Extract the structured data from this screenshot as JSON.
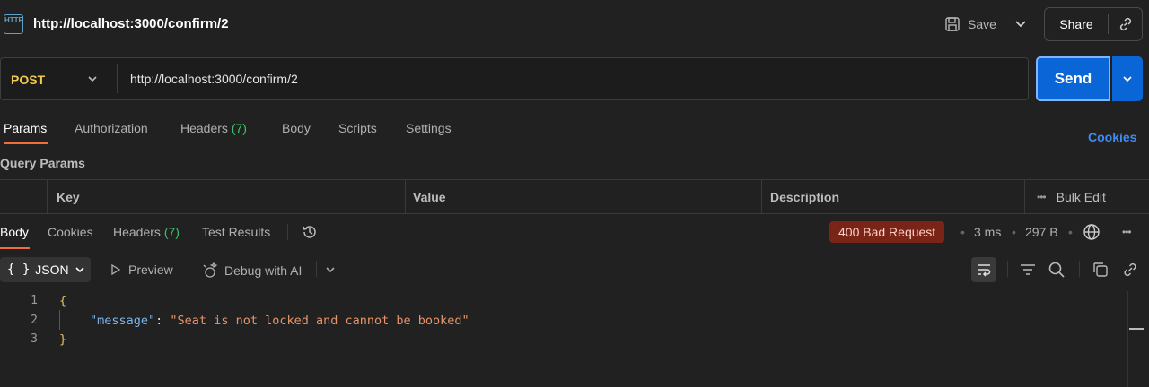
{
  "title_bar": {
    "icon_text": "HTTP",
    "url": "http://localhost:3000/confirm/2",
    "save_label": "Save",
    "share_label": "Share"
  },
  "request": {
    "method": "POST",
    "url": "http://localhost:3000/confirm/2",
    "send_label": "Send"
  },
  "request_tabs": [
    {
      "label": "Params"
    },
    {
      "label": "Authorization"
    },
    {
      "label": "Headers",
      "count": "(7)"
    },
    {
      "label": "Body"
    },
    {
      "label": "Scripts"
    },
    {
      "label": "Settings"
    }
  ],
  "cookies_link": "Cookies",
  "query_params": {
    "heading": "Query Params",
    "columns": [
      "Key",
      "Value",
      "Description"
    ],
    "bulk_edit": "Bulk Edit"
  },
  "response_tabs": [
    {
      "label": "Body"
    },
    {
      "label": "Cookies"
    },
    {
      "label": "Headers",
      "count": "(7)"
    },
    {
      "label": "Test Results"
    }
  ],
  "response_meta": {
    "status": "400 Bad Request",
    "time": "3 ms",
    "size": "297 B"
  },
  "response_toolbar": {
    "format": "JSON",
    "format_icon": "{ }",
    "preview": "Preview",
    "debug": "Debug with AI"
  },
  "response_body": {
    "line_numbers": [
      "1",
      "2",
      "3"
    ],
    "open_brace": "{",
    "key": "\"message\"",
    "colon": ": ",
    "value": "\"Seat is not locked and cannot be booked\"",
    "close_brace": "}"
  },
  "colors": {
    "accent": "#f26b3a",
    "send": "#0a66d6",
    "method": "#f0c94a",
    "status_error_bg": "#7a2418"
  }
}
